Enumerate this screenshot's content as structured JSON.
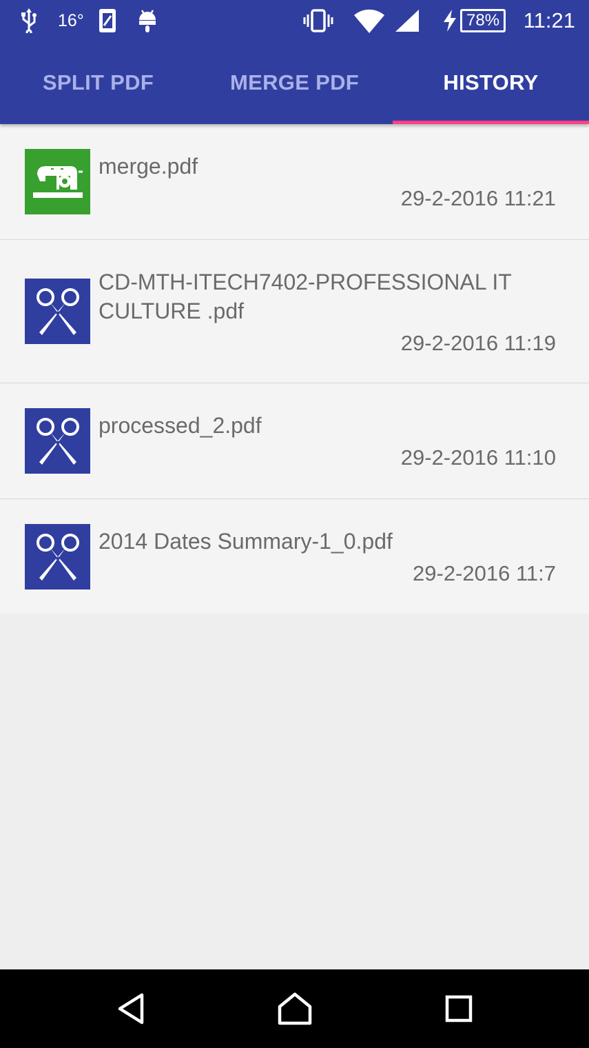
{
  "status_bar": {
    "temperature": "16°",
    "battery": "78%",
    "time": "11:21",
    "icons": [
      "usb-icon",
      "sd-card-icon",
      "android-icon",
      "vibrate-icon",
      "wifi-icon",
      "signal-icon",
      "charging-icon",
      "battery-icon"
    ]
  },
  "tabs": [
    {
      "label": "SPLIT PDF",
      "active": false
    },
    {
      "label": "MERGE PDF",
      "active": false
    },
    {
      "label": "HISTORY",
      "active": true
    }
  ],
  "history": [
    {
      "name": "merge.pdf",
      "date": "29-2-2016 11:21",
      "type": "merge",
      "icon": "sewing-machine-icon"
    },
    {
      "name": "CD-MTH-ITECH7402-PROFESSIONAL IT CULTURE .pdf",
      "date": "29-2-2016 11:19",
      "type": "split",
      "icon": "scissors-icon"
    },
    {
      "name": "processed_2.pdf",
      "date": "29-2-2016 11:10",
      "type": "split",
      "icon": "scissors-icon"
    },
    {
      "name": "2014 Dates Summary-1_0.pdf",
      "date": "29-2-2016 11:7",
      "type": "split",
      "icon": "scissors-icon"
    }
  ],
  "colors": {
    "primary": "#303f9f",
    "accent": "#ff4081",
    "merge_icon_bg": "#37a02f",
    "split_icon_bg": "#303ea0"
  },
  "nav_bar": {
    "icons": [
      "back-icon",
      "home-icon",
      "recents-icon"
    ]
  }
}
